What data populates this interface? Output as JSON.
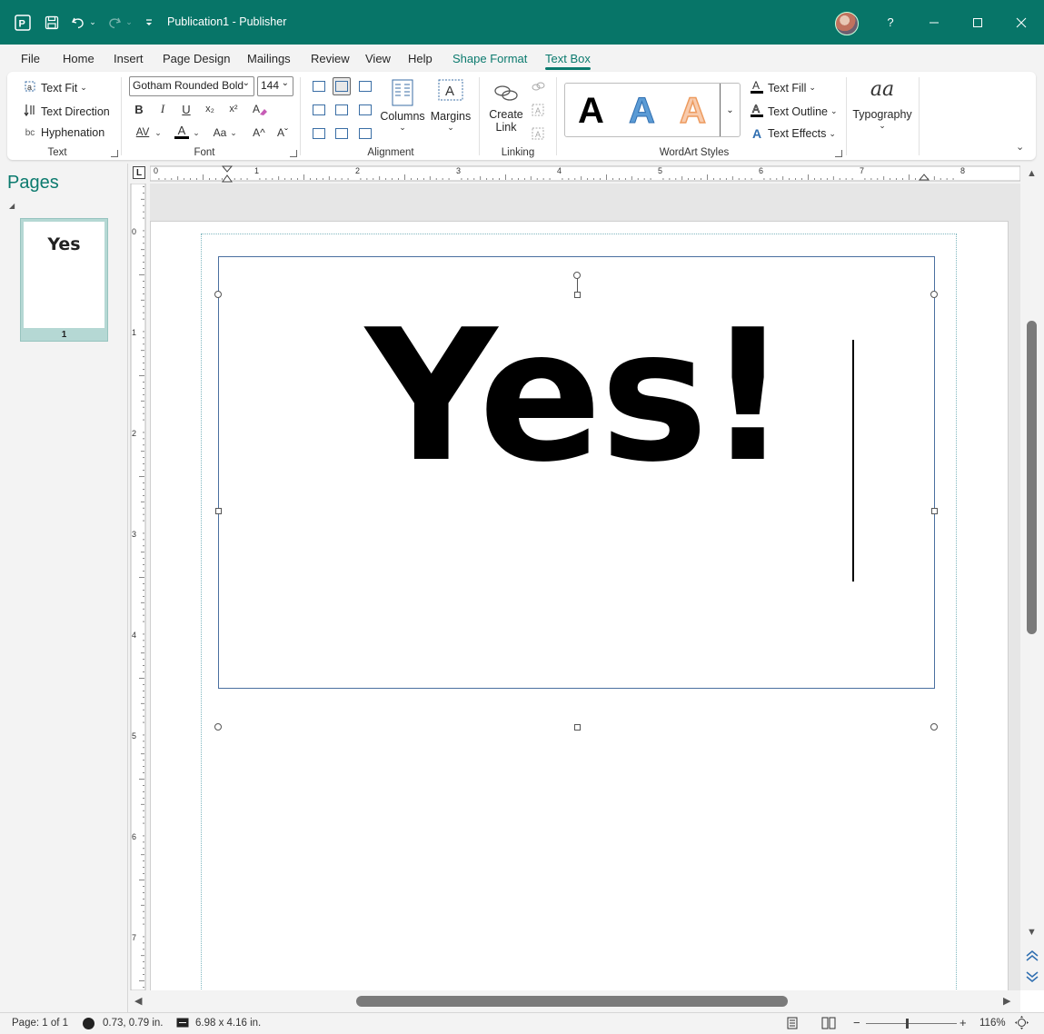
{
  "app": {
    "document_title": "Publication1",
    "separator": "-",
    "app_name": "Publisher",
    "help_label": "?"
  },
  "tabs": {
    "file": "File",
    "home": "Home",
    "insert": "Insert",
    "page_design": "Page Design",
    "mailings": "Mailings",
    "review": "Review",
    "view": "View",
    "help": "Help",
    "shape_format": "Shape Format",
    "text_box": "Text Box",
    "active": "Text Box"
  },
  "ribbon": {
    "text_group": {
      "label": "Text",
      "text_fit": "Text Fit",
      "text_direction": "Text Direction",
      "hyphenation": "Hyphenation"
    },
    "font_group": {
      "label": "Font",
      "font_name": "Gotham Rounded Bold",
      "font_size": "144",
      "bold": "B",
      "italic": "I",
      "underline": "U",
      "subscript": "x₂",
      "superscript": "x²",
      "spacing": "AV",
      "font_color": "A",
      "change_case": "Aa",
      "grow": "A^",
      "shrink": "Aˇ"
    },
    "alignment_group": {
      "label": "Alignment",
      "columns": "Columns",
      "margins": "Margins"
    },
    "linking_group": {
      "label": "Linking",
      "create_link_line1": "Create",
      "create_link_line2": "Link"
    },
    "wordart_group": {
      "label": "WordArt Styles",
      "sample": "A",
      "text_fill": "Text Fill",
      "text_outline": "Text Outline",
      "text_effects": "Text Effects"
    },
    "typography_group": {
      "glyph": "aa",
      "label": "Typography"
    }
  },
  "pages_pane": {
    "title": "Pages",
    "thumbnail_text": "Yes",
    "page_number": "1"
  },
  "ruler": {
    "corner": "L",
    "h_numbers": [
      "0",
      "1",
      "2",
      "3",
      "4",
      "5",
      "6",
      "7",
      "8"
    ],
    "v_numbers": [
      "0",
      "1",
      "2",
      "3",
      "4",
      "5",
      "6",
      "7"
    ]
  },
  "canvas": {
    "textbox_content": "Yes!"
  },
  "status_bar": {
    "page": "Page: 1 of 1",
    "position": "0.73, 0.79 in.",
    "size": "6.98 x 4.16 in.",
    "zoom": "116%",
    "zoom_level": 0.45
  },
  "colors": {
    "accent": "#077568",
    "contextual_tab": "#0b7a6e",
    "wordart_blue": "#5b9bd5",
    "wordart_orange": "#f4b183"
  }
}
